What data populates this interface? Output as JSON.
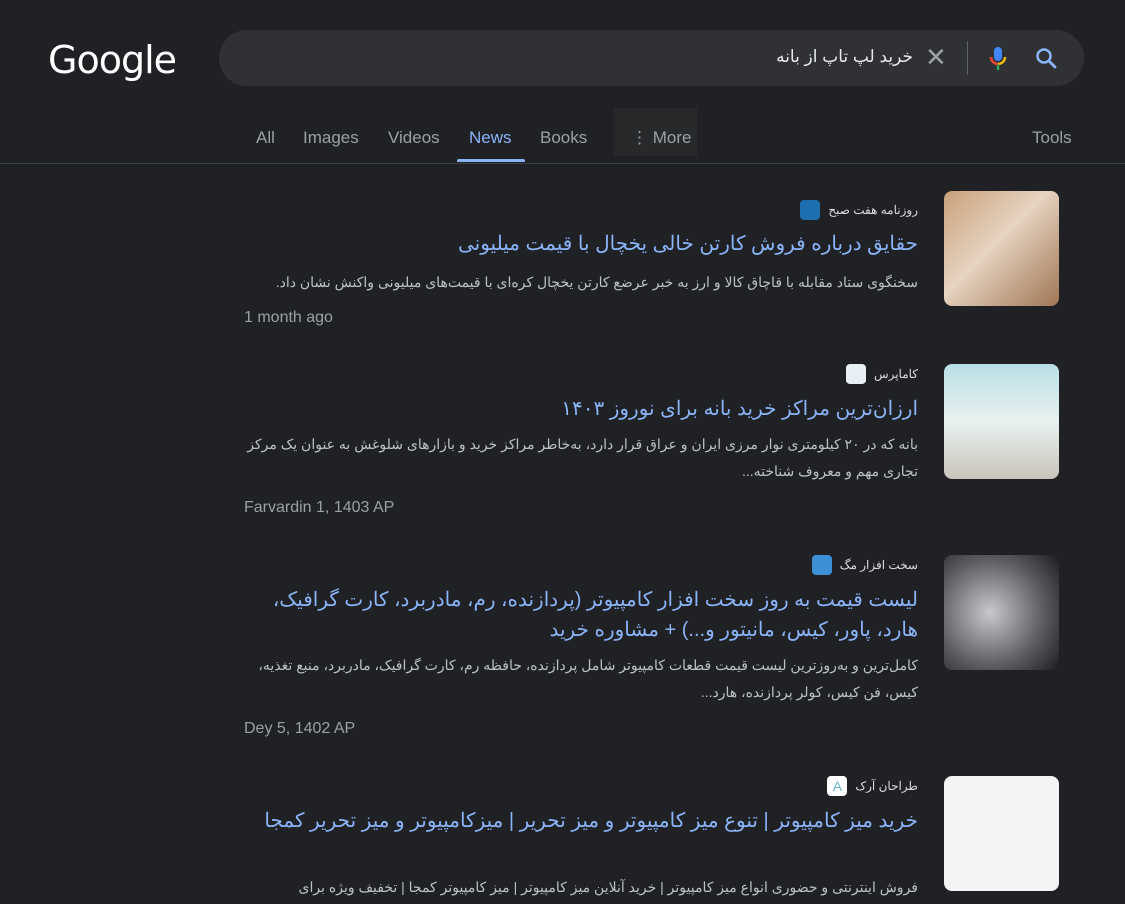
{
  "logo": "Google",
  "search": {
    "query": "خرید لپ تاپ از بانه"
  },
  "tabs": [
    {
      "label": "All"
    },
    {
      "label": "Images"
    },
    {
      "label": "Videos"
    },
    {
      "label": "News",
      "active": true
    },
    {
      "label": "Books"
    },
    {
      "label": "More"
    }
  ],
  "tools_label": "Tools",
  "colors": {
    "background": "#202124",
    "link": "#8ab4f8",
    "accent": "#8ab4f8"
  },
  "results": [
    {
      "source": "روزنامه هفت صبح",
      "title": "حقایق درباره فروش کارتن خالی یخچال با قیمت میلیونی",
      "snippet": "سخنگوی ستاد مقابله با قاچاق کالا و ارز به خبر عرضع کارتن یخچال کره‌ای با قیمت‌های میلیونی واکنش نشان داد.",
      "date": "1 month ago"
    },
    {
      "source": "کاماپرس",
      "title": "ارزان‌ترین مراکز خرید بانه برای نوروز ۱۴۰۳",
      "snippet": "بانه که در ۲۰ کیلومتری نوار مرزی ایران و عراق قرار دارد، به‌خاطر مراکز خرید و بازارهای شلوغش به عنوان یک مرکز تجاری مهم و معروف شناخته...",
      "date": "Farvardin 1, 1403 AP"
    },
    {
      "source": "سخت افزار مگ",
      "title": "لیست قیمت به روز سخت افزار کامپیوتر (پردازنده، رم، مادربرد، کارت گرافیک، هارد، پاور، کیس، مانیتور و...) + مشاوره خرید",
      "snippet": "کامل‌ترین و به‌روزترین لیست قیمت قطعات کامپیوتر شامل پردازنده، حافظه رم، کارت گرافیک، مادربرد، منبع تغذیه، کیس، فن کیس، کولر پردازنده، هارد...",
      "date": "Dey 5, 1402 AP"
    },
    {
      "source": "طراحان آرک",
      "title": "خرید میز کامپیوتر | تنوع میز کامپیوتر و میز تحریر | میزکامپیوتر و میز تحریر کمجا",
      "snippet": "فروش اینترنتی و حضوری انواع میز کامپیوتر | خرید آنلاین میز کامپیوتر | میز کامپیوتر کمجا | تخفیف ویژه برای",
      "date": ""
    }
  ]
}
